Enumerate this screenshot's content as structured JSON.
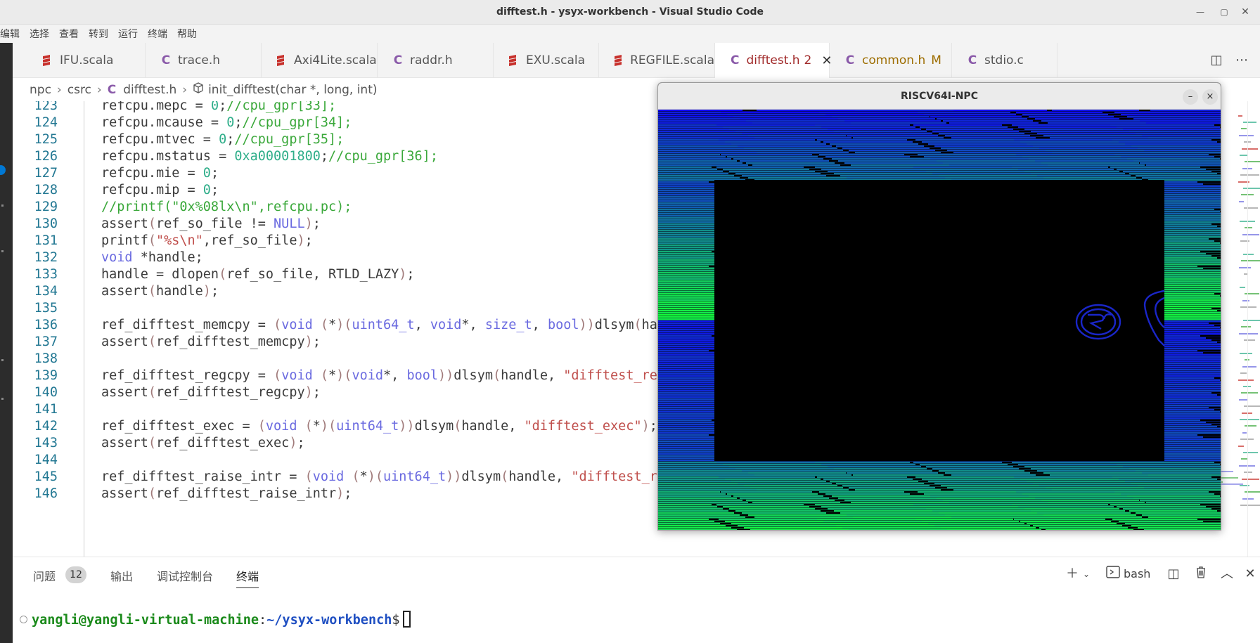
{
  "window": {
    "title": "difftest.h - ysyx-workbench - Visual Studio Code"
  },
  "menu": [
    "编辑",
    "选择",
    "查看",
    "转到",
    "运行",
    "终端",
    "帮助"
  ],
  "tabs": [
    {
      "label": "IFU.scala",
      "icon": "scala-icon"
    },
    {
      "label": "trace.h",
      "icon": "c-icon"
    },
    {
      "label": "Axi4Lite.scala",
      "icon": "scala-icon"
    },
    {
      "label": "raddr.h",
      "icon": "c-icon"
    },
    {
      "label": "EXU.scala",
      "icon": "scala-icon"
    },
    {
      "label": "REGFILE.scala",
      "icon": "scala-icon"
    },
    {
      "label": "difftest.h",
      "icon": "c-icon",
      "problems": "2",
      "active": true
    },
    {
      "label": "common.h",
      "icon": "c-icon",
      "status": "M"
    },
    {
      "label": "stdio.c",
      "icon": "c-icon"
    }
  ],
  "breadcrumb": {
    "folder1": "npc",
    "folder2": "csrc",
    "file": "difftest.h",
    "symbol": "init_difftest(char *, long, int)"
  },
  "editor": {
    "line_numbers": [
      "123",
      "124",
      "125",
      "126",
      "127",
      "128",
      "129",
      "130",
      "131",
      "132",
      "133",
      "134",
      "135",
      "136",
      "137",
      "138",
      "139",
      "140",
      "141",
      "142",
      "143",
      "144",
      "145",
      "146"
    ]
  },
  "npc_window": {
    "title": "RISCV64I-NPC",
    "minimize": "–",
    "close": "×"
  },
  "panel": {
    "tabs": {
      "problems": "问题",
      "problems_count": "12",
      "output": "输出",
      "debug_console": "调试控制台",
      "terminal": "终端"
    },
    "shell": "bash"
  },
  "terminal": {
    "user": "yangli@yangli-virtual-machine",
    "sep": ":",
    "path": "~/ysyx-workbench",
    "prompt": "$"
  }
}
